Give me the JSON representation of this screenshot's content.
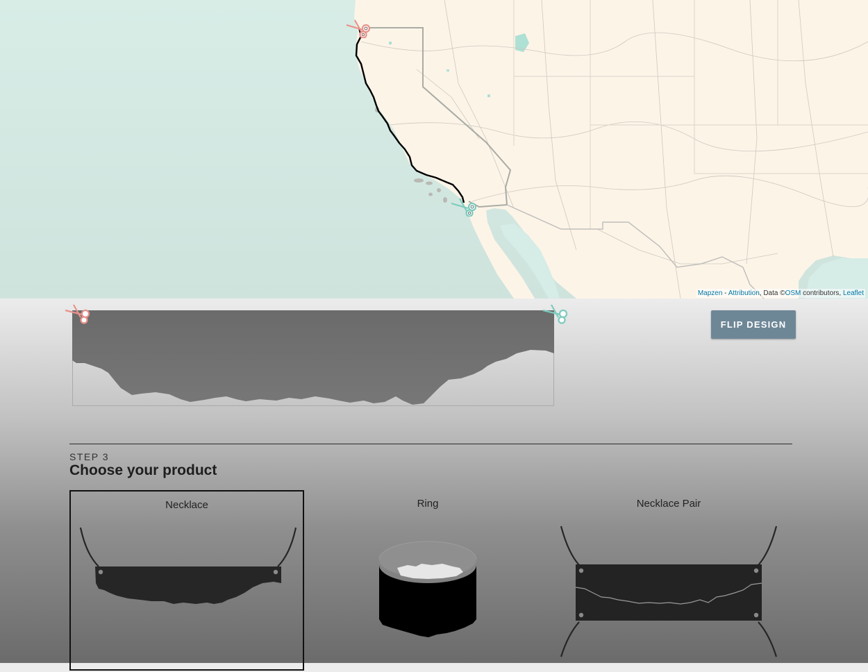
{
  "map": {
    "attribution": {
      "mapzen": "Mapzen",
      "sep": " - ",
      "attr_link": "Attribution",
      "data_text": ", Data ©",
      "osm": "OSM",
      "contributors": " contributors, ",
      "leaflet": "Leaflet"
    },
    "colors": {
      "ocean": "#d6ece6",
      "land": "#fdf4e8",
      "route": "#000000"
    }
  },
  "preview": {
    "start_marker": "scissors-icon",
    "end_marker": "scissors-icon"
  },
  "flip_button": {
    "label": "FLIP DESIGN"
  },
  "step3": {
    "step_label": "STEP 3",
    "title": "Choose your product",
    "products": [
      {
        "label": "Necklace",
        "selected": true
      },
      {
        "label": "Ring",
        "selected": false
      },
      {
        "label": "Necklace Pair",
        "selected": false
      }
    ]
  },
  "colors": {
    "start_scissors": "#e8928c",
    "end_scissors": "#7ccbbe",
    "button": "#6e8797"
  }
}
